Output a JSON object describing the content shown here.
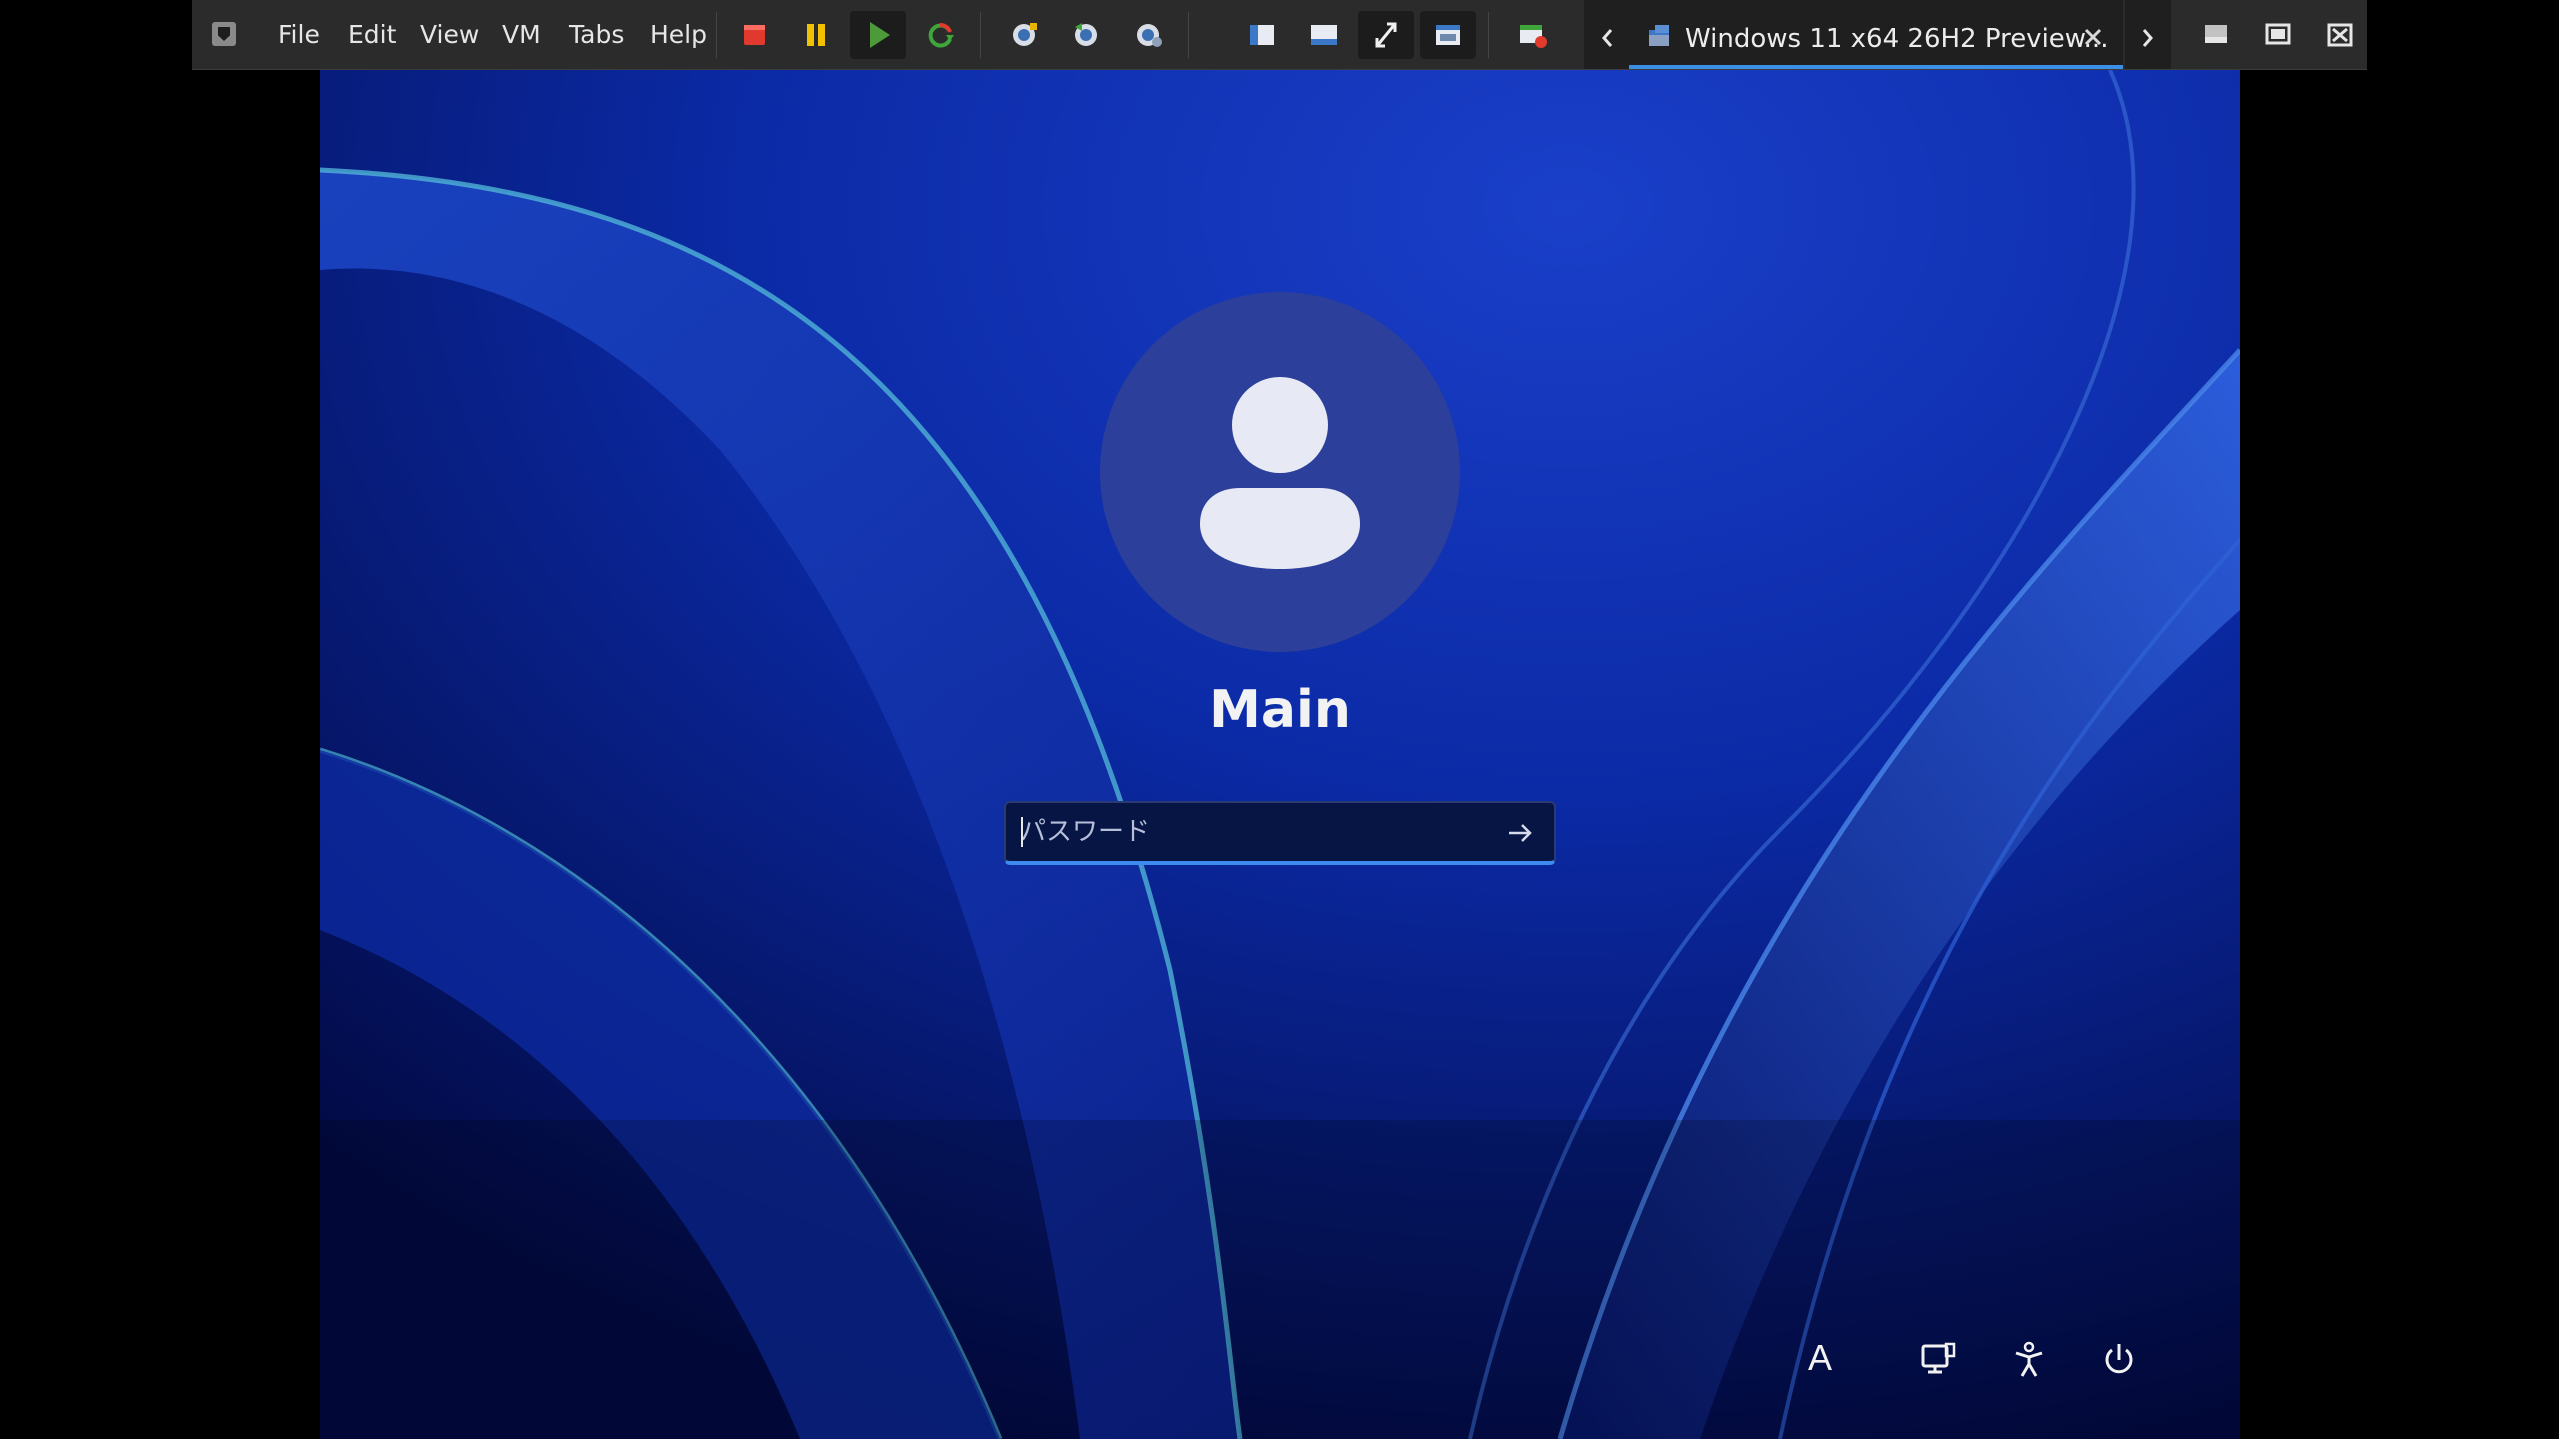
{
  "menu": {
    "file": "File",
    "edit": "Edit",
    "view": "View",
    "vm": "VM",
    "tabs": "Tabs",
    "help": "Help"
  },
  "toolbar_icons": [
    "power-off-icon",
    "suspend-icon",
    "power-on-icon",
    "reset-icon",
    "snapshot-icon",
    "revert-snapshot-icon",
    "snapshot-manager-icon",
    "show-library-icon",
    "console-view-icon",
    "full-screen-icon",
    "unity-icon",
    "remove-device-icon"
  ],
  "tab": {
    "title": "Windows 11 x64 26H2 Preview...",
    "accent": "#3c8fe6"
  },
  "lockscreen": {
    "username": "Main",
    "password_placeholder": "パスワード",
    "ime_mode": "A",
    "accent": "#3d8bef"
  }
}
